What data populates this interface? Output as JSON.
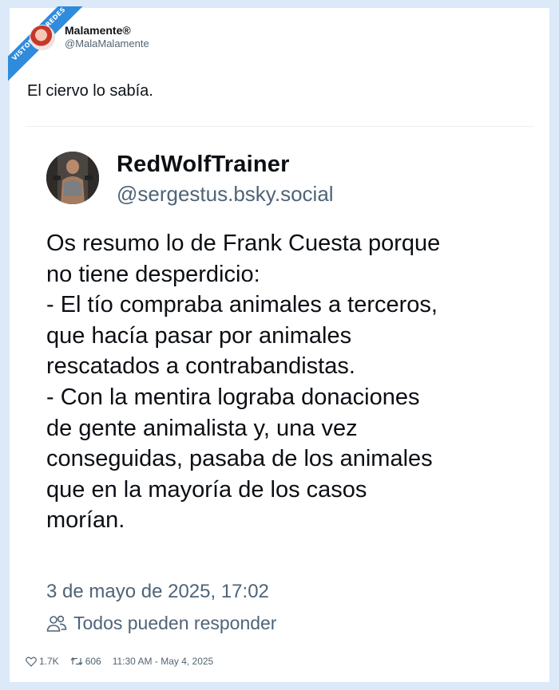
{
  "watermark": {
    "site": "VISTOENLASREDES",
    "tld": ".com"
  },
  "tweet": {
    "display_name": "Malamente®",
    "handle": "@MalaMalamente",
    "text": "El ciervo lo sabía.",
    "likes": "1.7K",
    "retweets": "606",
    "timestamp": "11:30 AM - May 4, 2025"
  },
  "quoted_post": {
    "display_name": "RedWolfTrainer",
    "handle": "@sergestus.bsky.social",
    "body_lines": [
      "Os resumo lo de Frank Cuesta porque",
      "no tiene desperdicio:",
      "- El tío compraba animales a terceros,",
      "que hacía pasar por animales",
      "rescatados a contrabandistas.",
      "- Con la mentira lograba donaciones",
      "de gente animalista y, una vez",
      "conseguidas, pasaba de los animales",
      "que en la mayoría de los casos",
      "morían."
    ],
    "date": "3 de mayo de 2025, 17:02",
    "reply_setting": "Todos pueden responder"
  },
  "colors": {
    "background": "#dbe9f8",
    "ribbon": "#2f8bdc",
    "secondary_text": "#4f6477"
  }
}
